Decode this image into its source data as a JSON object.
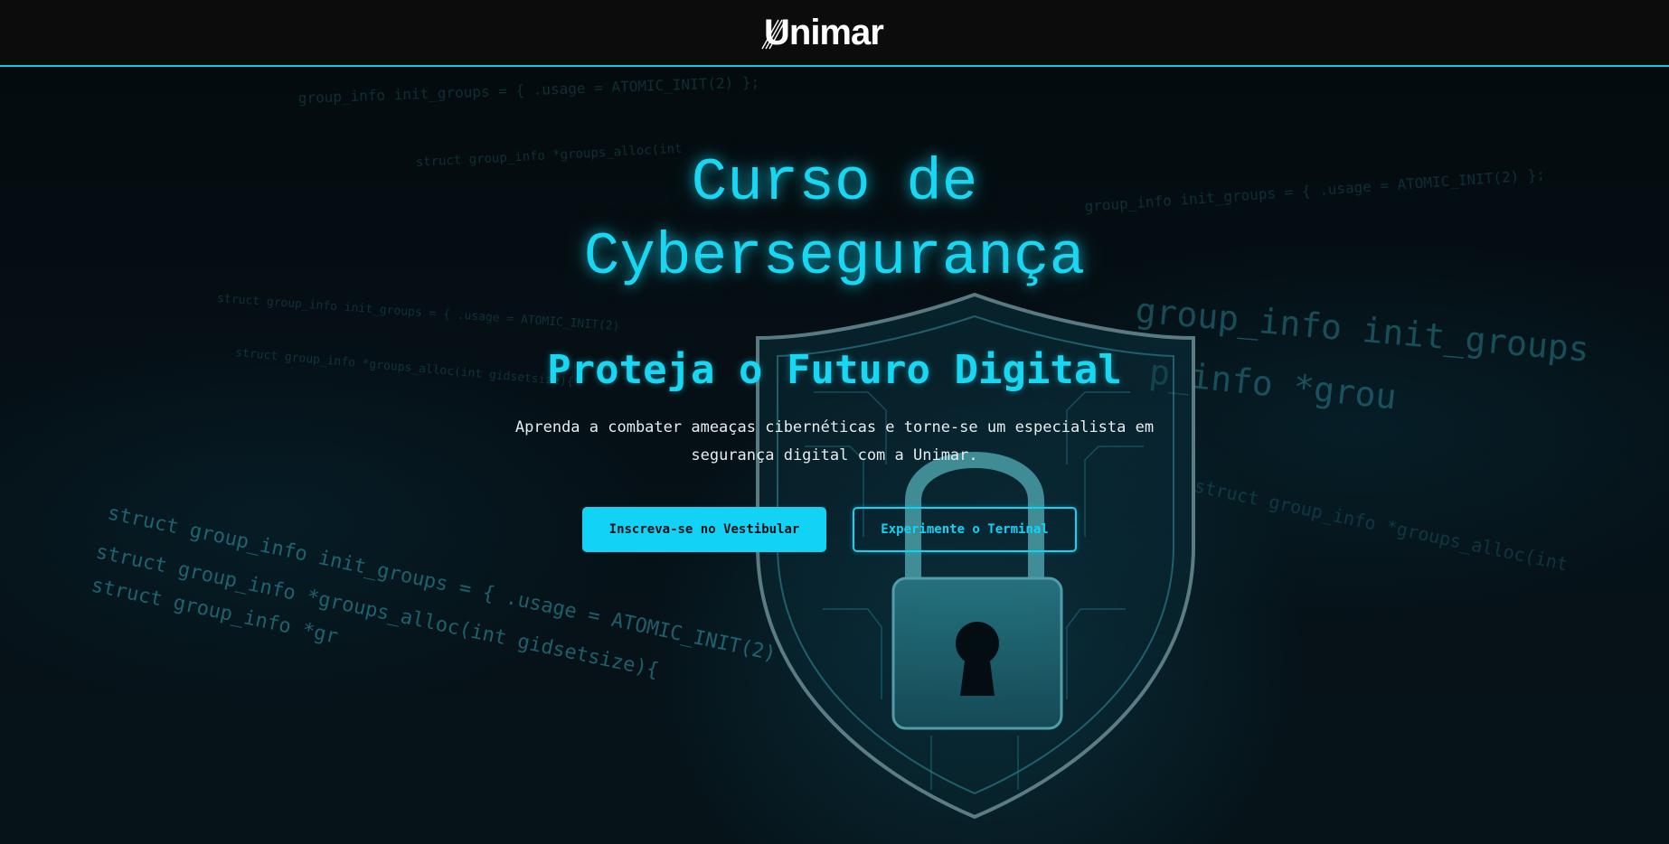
{
  "header": {
    "logo_text": "Unimar",
    "accent_color": "#14c8e8"
  },
  "hero": {
    "title_line1": "Curso de",
    "title_line2": "Cybersegurança",
    "subtitle": "Proteja o Futuro Digital",
    "description": "Aprenda a combater ameaças cibernéticas e torne-se um especialista em segurança digital com a Unimar.",
    "primary_button": "Inscreva-se no Vestibular",
    "secondary_button": "Experimente o Terminal",
    "background_icon": "shield-padlock-icon"
  },
  "background_code": {
    "line1": "struct group_info init_groups = { .usage = ATOMIC_INIT(2)",
    "line2": "struct group_info *groups_alloc(int gidsetsize){",
    "line3": "struct group_info *gr",
    "line4": "group_info init_groups",
    "line5": "p_info *grou",
    "line6": "struct group_info *groups_alloc(int",
    "line7": "group_info init_groups = { .usage = ATOMIC_INIT(2) };"
  },
  "colors": {
    "accent": "#12d3f5",
    "text": "#e6edf0",
    "background": "#03090c"
  }
}
